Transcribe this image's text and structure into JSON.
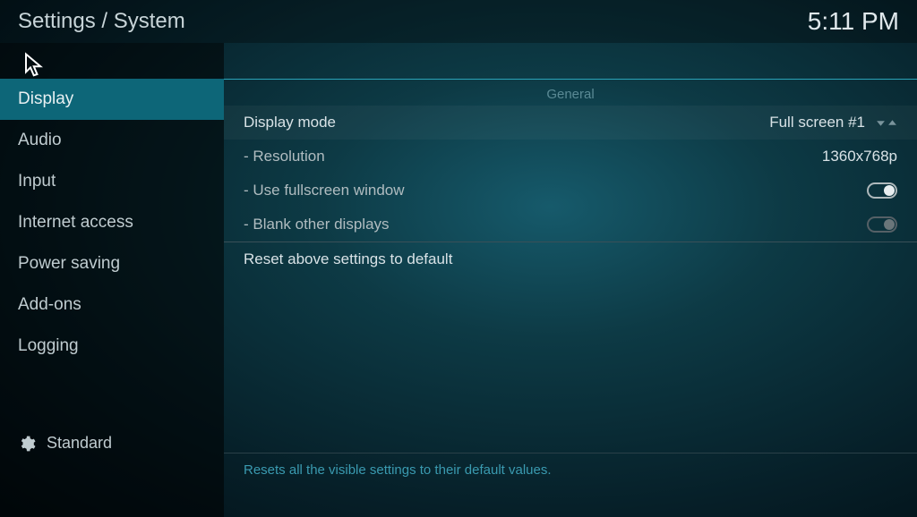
{
  "header": {
    "breadcrumb": "Settings / System",
    "clock": "5:11 PM"
  },
  "sidebar": {
    "items": [
      {
        "label": "Display"
      },
      {
        "label": "Audio"
      },
      {
        "label": "Input"
      },
      {
        "label": "Internet access"
      },
      {
        "label": "Power saving"
      },
      {
        "label": "Add-ons"
      },
      {
        "label": "Logging"
      }
    ],
    "level_label": "Standard"
  },
  "content": {
    "section": "General",
    "rows": {
      "display_mode": {
        "label": "Display mode",
        "value": "Full screen #1"
      },
      "resolution": {
        "label": "- Resolution",
        "value": "1360x768p"
      },
      "fullscreen": {
        "label": "- Use fullscreen window"
      },
      "blank": {
        "label": "- Blank other displays"
      },
      "reset": {
        "label": "Reset above settings to default"
      }
    },
    "help_text": "Resets all the visible settings to their default values."
  }
}
